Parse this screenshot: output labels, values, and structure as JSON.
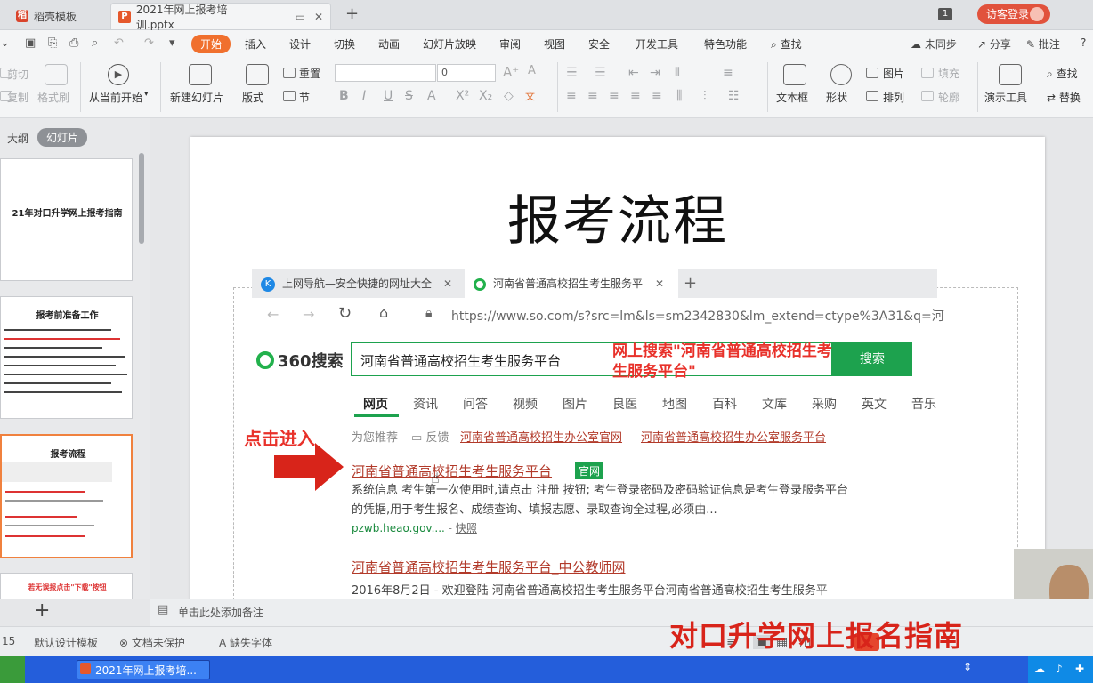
{
  "tabs": {
    "home": "稻壳模板",
    "document": "2021年网上报考培训.pptx",
    "count_badge": "1",
    "login": "访客登录"
  },
  "menu": {
    "items": [
      "开始",
      "插入",
      "设计",
      "切换",
      "动画",
      "幻灯片放映",
      "审阅",
      "视图",
      "安全",
      "开发工具",
      "特色功能"
    ],
    "search": "查找",
    "sync": "未同步",
    "share": "分享",
    "annotate": "批注"
  },
  "ribbon": {
    "cut": "剪切",
    "copy": "复制",
    "format_painter": "格式刷",
    "play_from_current": "从当前开始",
    "new_slide": "新建幻灯片",
    "layout": "版式",
    "reset": "重置",
    "section": "节",
    "font_size_value": "0",
    "textbox": "文本框",
    "shape": "形状",
    "picture": "图片",
    "arrange": "排列",
    "fill": "填充",
    "outline": "轮廓",
    "present_tool": "演示工具",
    "find": "查找",
    "replace": "替换"
  },
  "left_pane": {
    "outline": "大纲",
    "slides": "幻灯片",
    "thumb1_title": "21年对口升学网上报考指南",
    "thumb2_title": "报考前准备工作",
    "thumb3_title": "报考流程",
    "thumb4_title": "若无误报点击\"下载\"按钮"
  },
  "slide": {
    "title": "报考流程"
  },
  "browser": {
    "tab1": "上网导航—安全快捷的网址大全",
    "tab2": "河南省普通高校招生考生服务平",
    "url": "https://www.so.com/s?src=lm&ls=sm2342830&lm_extend=ctype%3A31&q=河",
    "logo": "360搜索",
    "search_text": "河南省普通高校招生考生服务平台",
    "search_button": "搜索",
    "annotation_search": "网上搜索\"河南省普通高校招生考生服务平台\"",
    "nav": [
      "网页",
      "资讯",
      "问答",
      "视频",
      "图片",
      "良医",
      "地图",
      "百科",
      "文库",
      "采购",
      "英文",
      "音乐"
    ],
    "rec_label": "为您推荐",
    "feedback": "反馈",
    "rec_links": [
      "河南省普通高校招生办公室官网",
      "河南省普通高校招生办公室服务平台"
    ],
    "annotation_click": "点击进入",
    "result1_title": "河南省普通高校招生考生服务平台",
    "result1_tag": "官网",
    "result1_desc": "系统信息 考生第一次使用时,请点击 注册 按钮; 考生登录密码及密码验证信息是考生登录服务平台的凭据,用于考生报名、成绩查询、填报志愿、录取查询全过程,必须由...",
    "result1_url": "pzwb.heao.gov....",
    "result1_snapshot": "快照",
    "result2_title": "河南省普通高校招生考生服务平台_中公教师网",
    "result2_desc": "2016年8月2日 - 欢迎登陆 河南省普通高校招生考生服务平台河南省普通高校招生考生服务平"
  },
  "notes": {
    "placeholder": "单击此处添加备注"
  },
  "status": {
    "page": "15",
    "template": "默认设计模板",
    "protect": "文档未保护",
    "font_missing": "缺失字体"
  },
  "watermark": "对口升学网上报名指南",
  "taskbar": {
    "item": "2021年网上报考培..."
  }
}
